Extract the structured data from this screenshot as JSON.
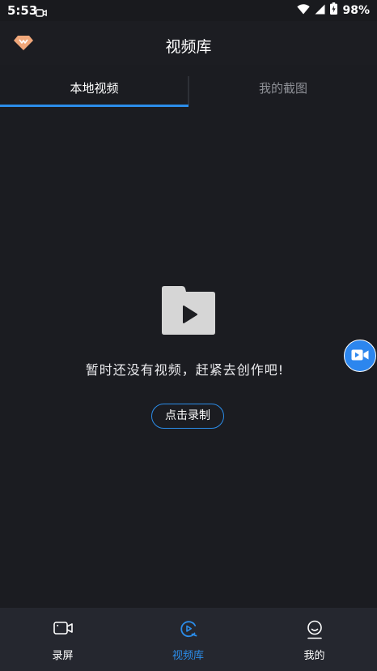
{
  "status_bar": {
    "time": "5:53",
    "battery": "98%"
  },
  "app_bar": {
    "title": "视频库"
  },
  "tabs": [
    {
      "label": "本地视频",
      "active": true
    },
    {
      "label": "我的截图",
      "active": false
    }
  ],
  "empty_state": {
    "message": "暂时还没有视频，赶紧去创作吧!",
    "button_label": "点击录制"
  },
  "bottom_nav": [
    {
      "label": "录屏",
      "icon": "camera-icon",
      "active": false
    },
    {
      "label": "视频库",
      "icon": "video-library-icon",
      "active": true
    },
    {
      "label": "我的",
      "icon": "profile-icon",
      "active": false
    }
  ],
  "colors": {
    "accent": "#2b8dea",
    "background": "#1b1c21",
    "nav_background": "#25272f",
    "vip_icon": "#f0a77a"
  }
}
